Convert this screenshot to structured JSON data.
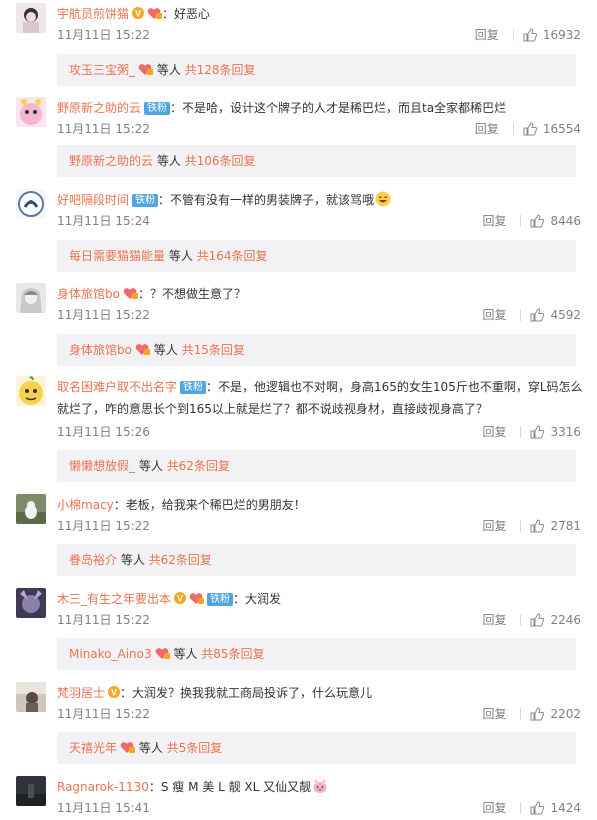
{
  "comments": [
    {
      "username": "宇航员煎饼猫",
      "has_v": true,
      "has_heart": true,
      "has_tiefen": false,
      "text": "：好恶心",
      "time": "11月11日 15:22",
      "reply_label": "回复",
      "likes": "16932",
      "reply_box": {
        "user": "攻玉三宝粥_",
        "has_heart": true,
        "middle": " 等人 ",
        "total": "共128条回复"
      }
    },
    {
      "username": "野原新之助的云",
      "has_v": false,
      "has_heart": false,
      "has_tiefen": true,
      "text": "：不是哈，设计这个牌子的人才是稀巴烂，而且ta全家都稀巴烂",
      "time": "11月11日 15:22",
      "reply_label": "回复",
      "likes": "16554",
      "reply_box": {
        "user": "野原新之助的云",
        "has_heart": false,
        "middle": " 等人 ",
        "total": "共106条回复"
      }
    },
    {
      "username": "好吧隔段时间",
      "has_v": false,
      "has_heart": false,
      "has_tiefen": true,
      "text": "：不管有没有一样的男装牌子，就该骂哦",
      "time": "11月11日 15:24",
      "reply_label": "回复",
      "likes": "8446",
      "reply_box": {
        "user": "每日需要猫猫能量",
        "has_heart": false,
        "middle": " 等人 ",
        "total": "共164条回复"
      }
    },
    {
      "username": "身体旅馆bo",
      "has_v": false,
      "has_heart": true,
      "has_tiefen": false,
      "text": "：？不想做生意了？",
      "time": "11月11日 15:22",
      "reply_label": "回复",
      "likes": "4592",
      "reply_box": {
        "user": "身体旅馆bo",
        "has_heart": true,
        "middle": " 等人 ",
        "total": "共15条回复"
      }
    },
    {
      "username": "取名困难户取不出名字",
      "has_v": false,
      "has_heart": false,
      "has_tiefen": true,
      "text": "：不是，他逻辑也不对啊，身高165的女生105斤也不重啊，穿L码怎么就烂了，咋的意思长个到165以上就是烂了？都不说歧视身材，直接歧视身高了？",
      "time": "11月11日 15:26",
      "reply_label": "回复",
      "likes": "3316",
      "reply_box": {
        "user": "懒懒想放假_",
        "has_heart": false,
        "middle": " 等人 ",
        "total": "共62条回复"
      }
    },
    {
      "username": "小棉macy",
      "has_v": false,
      "has_heart": false,
      "has_tiefen": false,
      "text": "：老板，给我来个稀巴烂的男朋友！",
      "time": "11月11日 15:22",
      "reply_label": "回复",
      "likes": "2781",
      "reply_box": {
        "user": "眷岛裕介",
        "has_heart": false,
        "middle": " 等人 ",
        "total": "共62条回复"
      }
    },
    {
      "username": "木三_有生之年要出本",
      "has_v": true,
      "has_heart": true,
      "has_tiefen": true,
      "text": "：大润发",
      "time": "11月11日 15:22",
      "reply_label": "回复",
      "likes": "2246",
      "reply_box": {
        "user": "Minako_Aino3",
        "has_heart": true,
        "middle": " 等人 ",
        "total": "共85条回复"
      }
    },
    {
      "username": "梵羽居士",
      "has_v": true,
      "has_heart": false,
      "has_tiefen": false,
      "text": "：大润发？换我我就工商局投诉了，什么玩意儿",
      "time": "11月11日 15:22",
      "reply_label": "回复",
      "likes": "2202",
      "reply_box": {
        "user": "天禧光年",
        "has_heart": true,
        "middle": " 等人 ",
        "total": "共5条回复"
      }
    },
    {
      "username": "Ragnarok-1130",
      "has_v": false,
      "has_heart": false,
      "has_tiefen": false,
      "text": "：S 瘦  M 美  L 靓 XL 又仙又靓",
      "time": "11月11日 15:41",
      "reply_label": "回复",
      "likes": "1424",
      "reply_box": null
    }
  ],
  "colors": {
    "username": "#eb7350",
    "reply_bg": "#f2f2f5",
    "tiefen": "#4ea5e0",
    "vip": "#f5a623"
  },
  "icons": [
    "v-badge-icon",
    "heart-badge-icon",
    "thumb-up-icon",
    "avatar"
  ]
}
